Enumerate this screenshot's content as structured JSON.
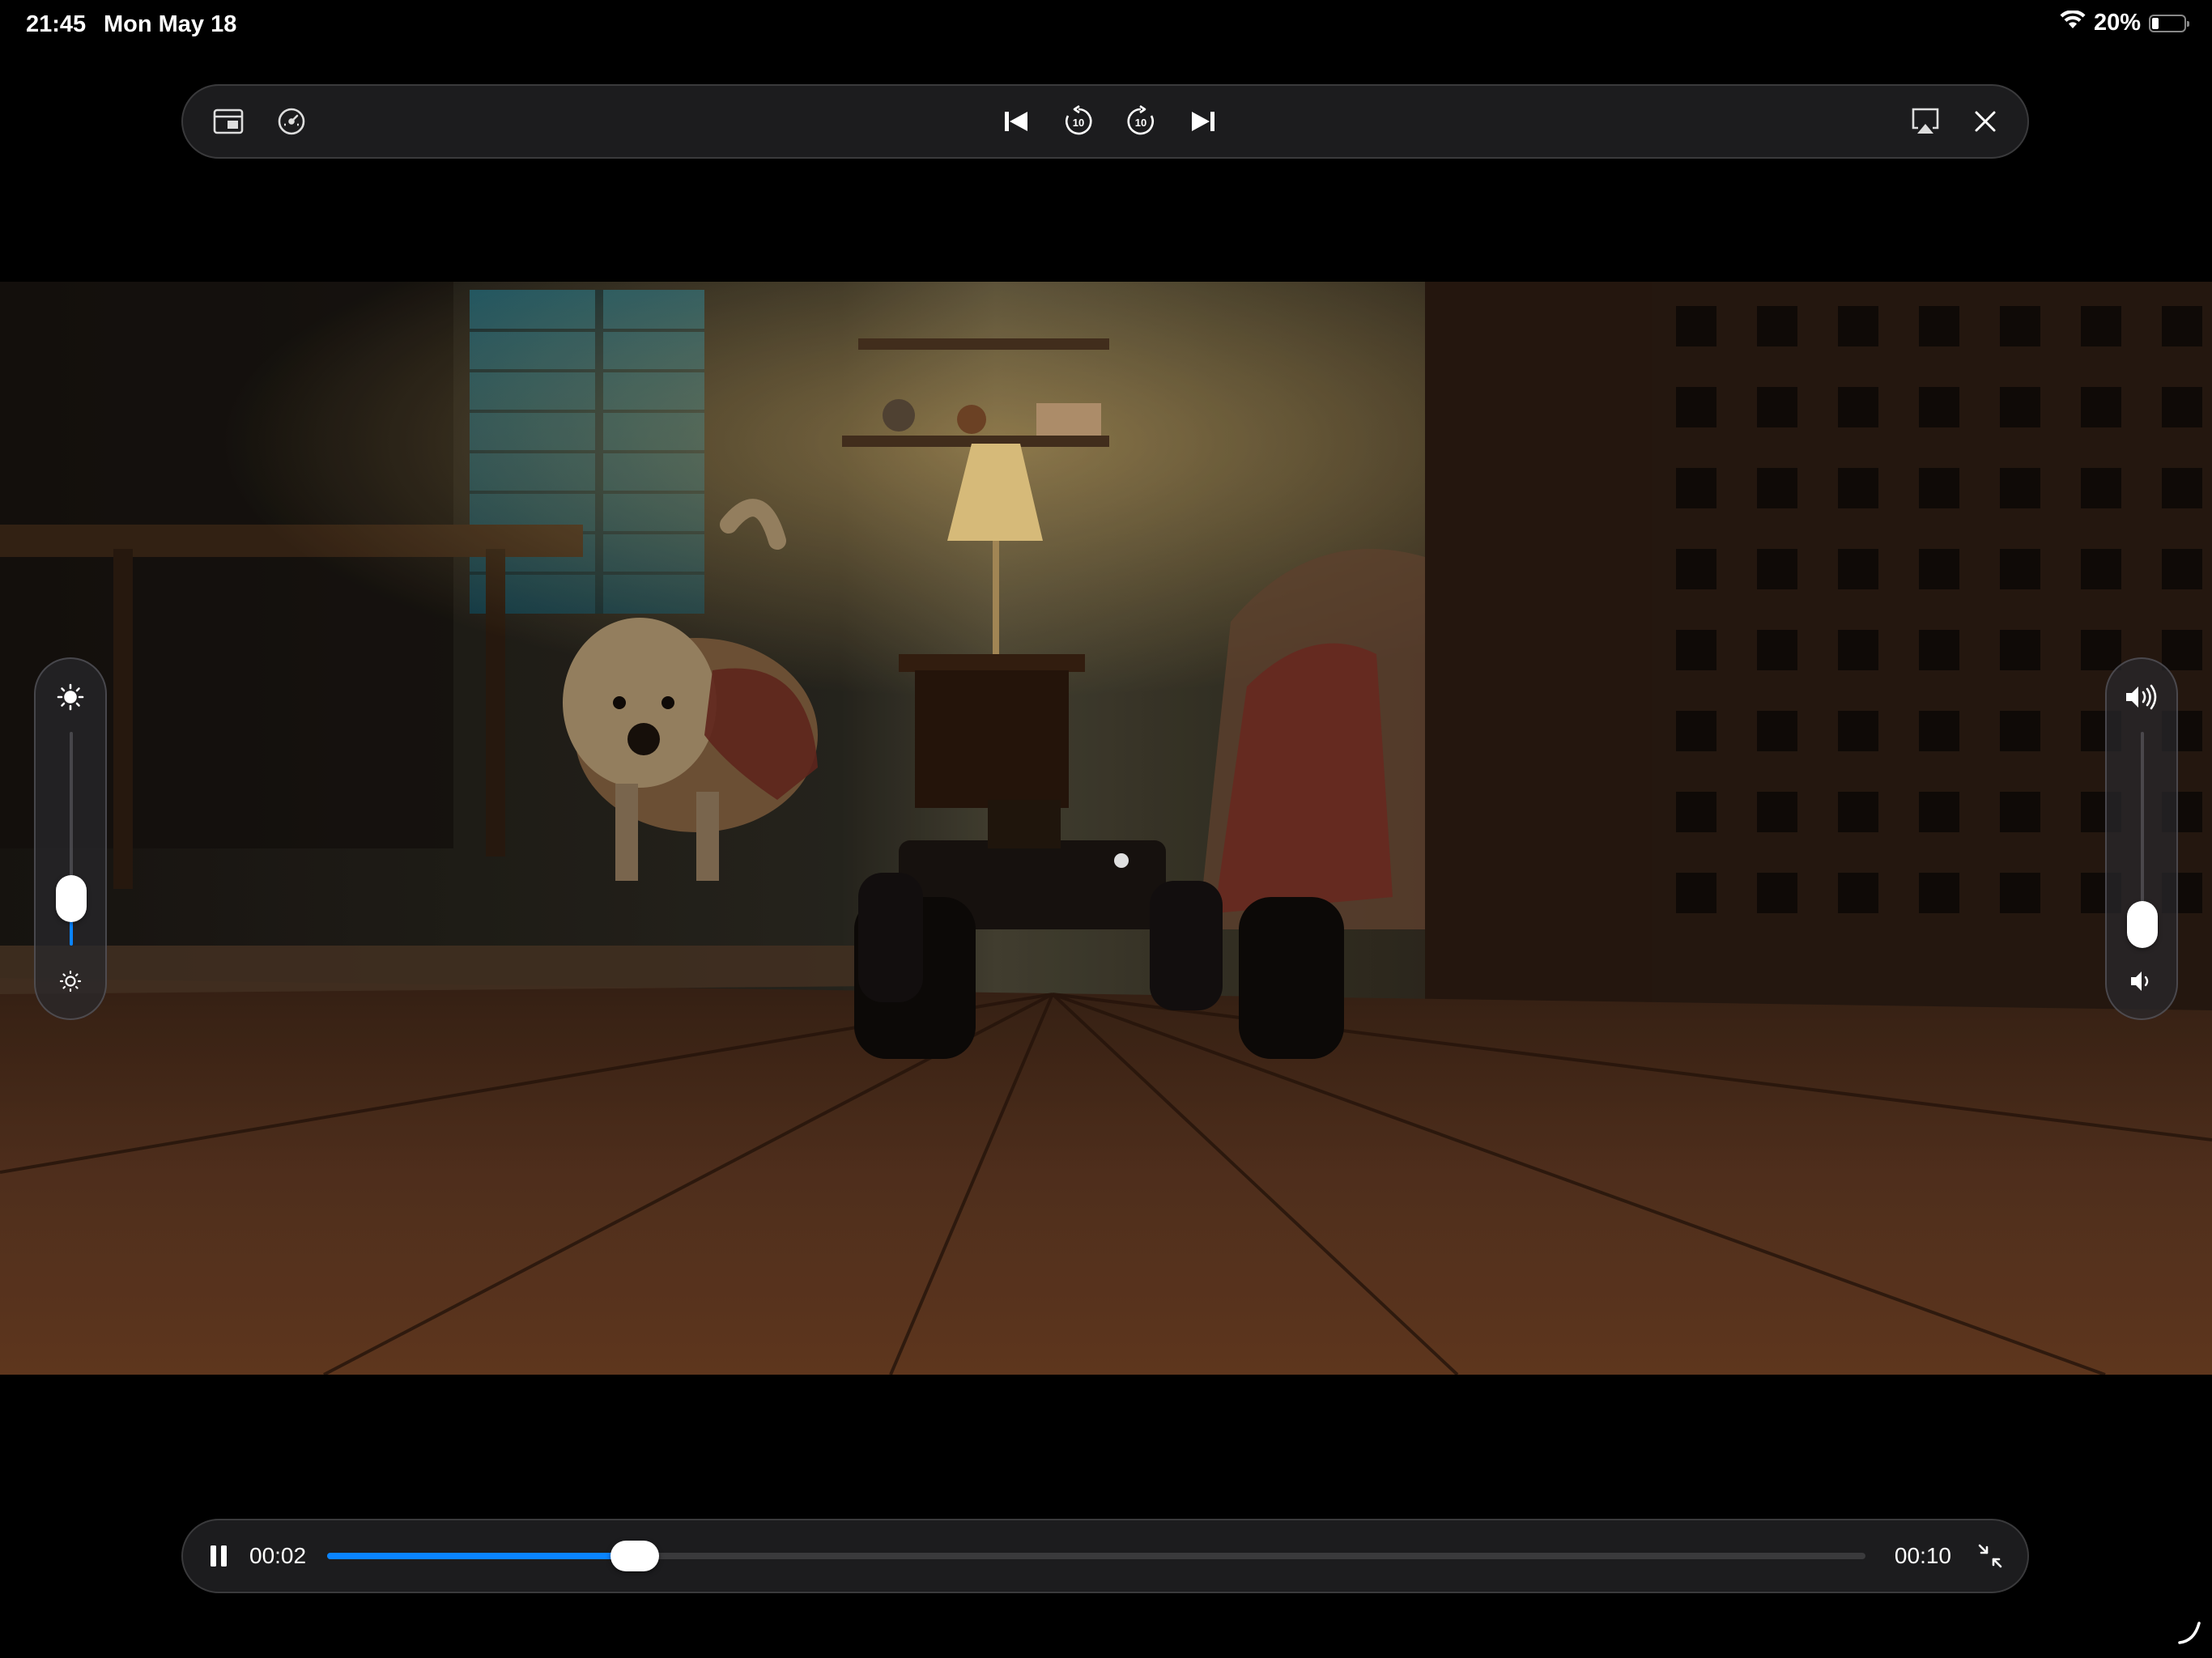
{
  "status_bar": {
    "time": "21:45",
    "date": "Mon May 18",
    "battery_percent": "20%",
    "battery_level": 0.2,
    "wifi_icon": "wifi-icon",
    "battery_icon": "battery-icon"
  },
  "top_bar": {
    "left_icons": [
      "picture-in-picture-icon",
      "playback-speed-icon"
    ],
    "center_icons": [
      "skip-previous-icon",
      "rewind-10-icon",
      "forward-10-icon",
      "skip-next-icon"
    ],
    "right_icons": [
      "airplay-icon",
      "close-icon"
    ],
    "rewind_seconds": "10",
    "forward_seconds": "10"
  },
  "video": {
    "scene": "dog-and-rc-car-room"
  },
  "brightness": {
    "level": 0.22,
    "top_icon": "brightness-high-icon",
    "bottom_icon": "brightness-low-icon"
  },
  "volume": {
    "level": 0.1,
    "top_icon": "volume-high-icon",
    "bottom_icon": "volume-low-icon"
  },
  "bottom_bar": {
    "play_state_icon": "pause-icon",
    "current_time": "00:02",
    "total_time": "00:10",
    "progress": 0.2,
    "exit_fullscreen_icon": "exit-fullscreen-icon"
  },
  "colors": {
    "accent": "#0a84ff",
    "bar_background": "#1c1c1e"
  }
}
